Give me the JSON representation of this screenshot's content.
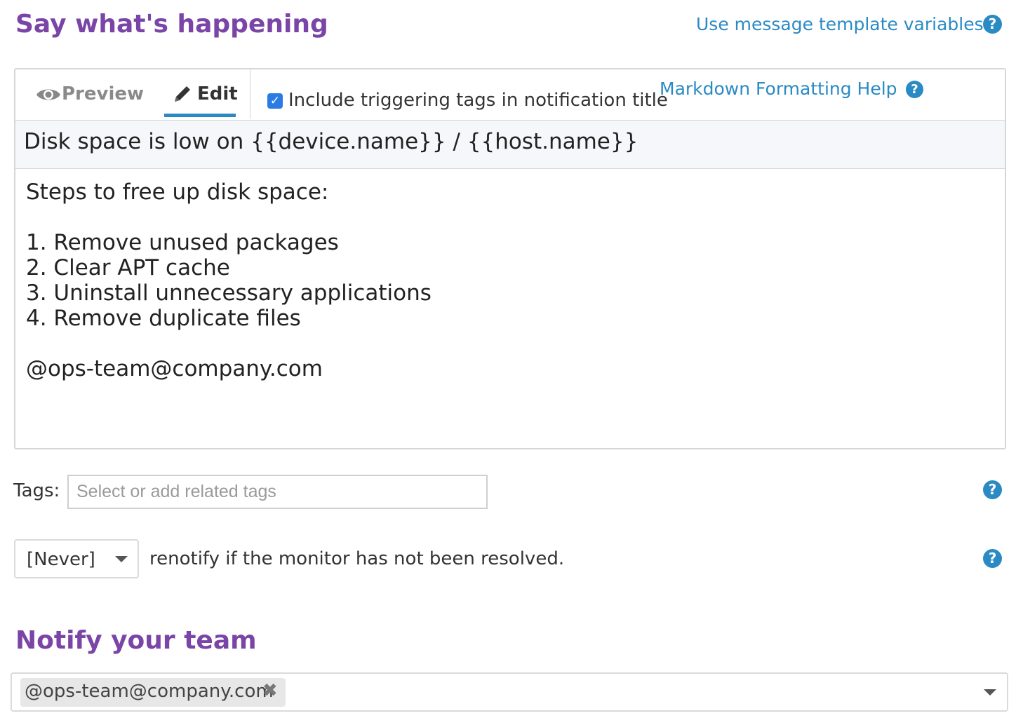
{
  "header": {
    "title": "Say what's happening",
    "template_link": "Use message template variables"
  },
  "editor": {
    "tabs": [
      {
        "label": "Preview",
        "icon": "eye-icon"
      },
      {
        "label": "Edit",
        "icon": "pencil-icon",
        "active": true
      }
    ],
    "include_tags_label": "Include triggering tags in notification title",
    "include_tags_checked": true,
    "markdown_help": "Markdown Formatting Help",
    "title_value": "Disk space is low on {{device.name}} / {{host.name}}",
    "body_value": "Steps to free up disk space:\n\n1. Remove unused packages\n2. Clear APT cache\n3. Uninstall unnecessary applications\n4. Remove duplicate files\n\n@ops-team@company.com"
  },
  "tags": {
    "label": "Tags:",
    "placeholder": "Select or add related tags"
  },
  "renotify": {
    "selected": "[Never]",
    "text": "renotify if the monitor has not been resolved."
  },
  "notify": {
    "title": "Notify your team",
    "recipients": [
      "@ops-team@company.com"
    ]
  },
  "colors": {
    "heading": "#7a45a6",
    "link": "#2a8ac4",
    "checkbox": "#2c7be5"
  }
}
